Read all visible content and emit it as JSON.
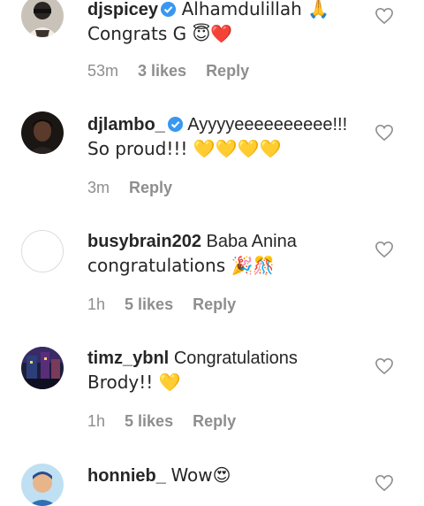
{
  "comments": [
    {
      "username": "djspicey",
      "verified": true,
      "text": "Alhamdulillah 🙏",
      "text2": "Congrats G 😇❤️",
      "time": "53m",
      "likes": "3 likes",
      "reply": "Reply"
    },
    {
      "username": "djlambo_",
      "verified": true,
      "text": "Ayyyyeeeeeeeeee!!!",
      "text2": "So proud!!! 💛💛💛💛",
      "time": "3m",
      "likes": "",
      "reply": "Reply"
    },
    {
      "username": "busybrain202",
      "verified": false,
      "text": "Baba Anina",
      "text2": "congratulations 🎉🎊",
      "time": "1h",
      "likes": "5 likes",
      "reply": "Reply"
    },
    {
      "username": "timz_ybnl",
      "verified": false,
      "text": "Congratulations",
      "text2": "Brody!! 💛",
      "time": "1h",
      "likes": "5 likes",
      "reply": "Reply"
    },
    {
      "username": "honnieb_",
      "verified": false,
      "text": "Wow😍",
      "text2": "",
      "time": "",
      "likes": "",
      "reply": ""
    }
  ],
  "icons": {
    "verified": "verified-badge-icon",
    "like": "heart-outline-icon"
  },
  "colors": {
    "verified": "#3897f0",
    "meta_text": "#8e8e8e",
    "text": "#262626"
  }
}
